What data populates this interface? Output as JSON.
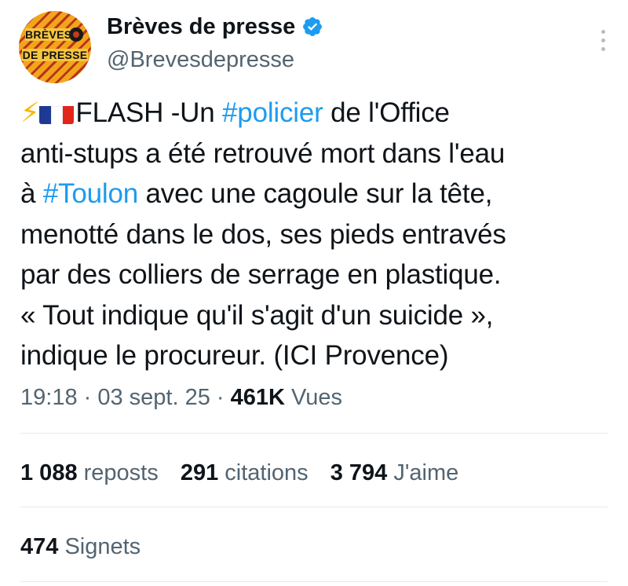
{
  "author": {
    "avatar_text_line1": "BRÈVES",
    "avatar_text_line2": "DE PRESSE",
    "display_name": "Brèves de presse",
    "handle": "@Brevesdepresse"
  },
  "tweet": {
    "lines": [
      {
        "flash": "FLASH -Un ",
        "hashtag1": "#policier",
        "rest": " de l'Office"
      },
      {
        "text": "anti-stups a été retrouvé mort dans l'eau"
      },
      {
        "prefix": "à ",
        "hashtag2": "#Toulon",
        "rest": " avec une cagoule sur la tête,"
      },
      {
        "text": "menotté dans le dos, ses pieds entravés"
      },
      {
        "text": "par des colliers de serrage en plastique."
      },
      {
        "text": "« Tout indique qu'il s'agit d'un suicide »,"
      },
      {
        "text": "indique le procureur. (ICI Provence)"
      }
    ],
    "time": "19:18",
    "date": "03 sept. 25",
    "views_count": "461K",
    "views_label": "Vues"
  },
  "stats": {
    "reposts_count": "1 088",
    "reposts_label": "reposts",
    "quotes_count": "291",
    "quotes_label": "citations",
    "likes_count": "3 794",
    "likes_label": "J'aime",
    "bookmarks_count": "474",
    "bookmarks_label": "Signets"
  },
  "colors": {
    "hashtag": "#1d9bf0",
    "verified": "#1d9bf0",
    "secondary_text": "#536471",
    "primary_text": "#0f1419"
  },
  "icons": [
    "verified-badge-icon",
    "more-options-icon",
    "lightning-emoji",
    "france-flag-emoji"
  ]
}
